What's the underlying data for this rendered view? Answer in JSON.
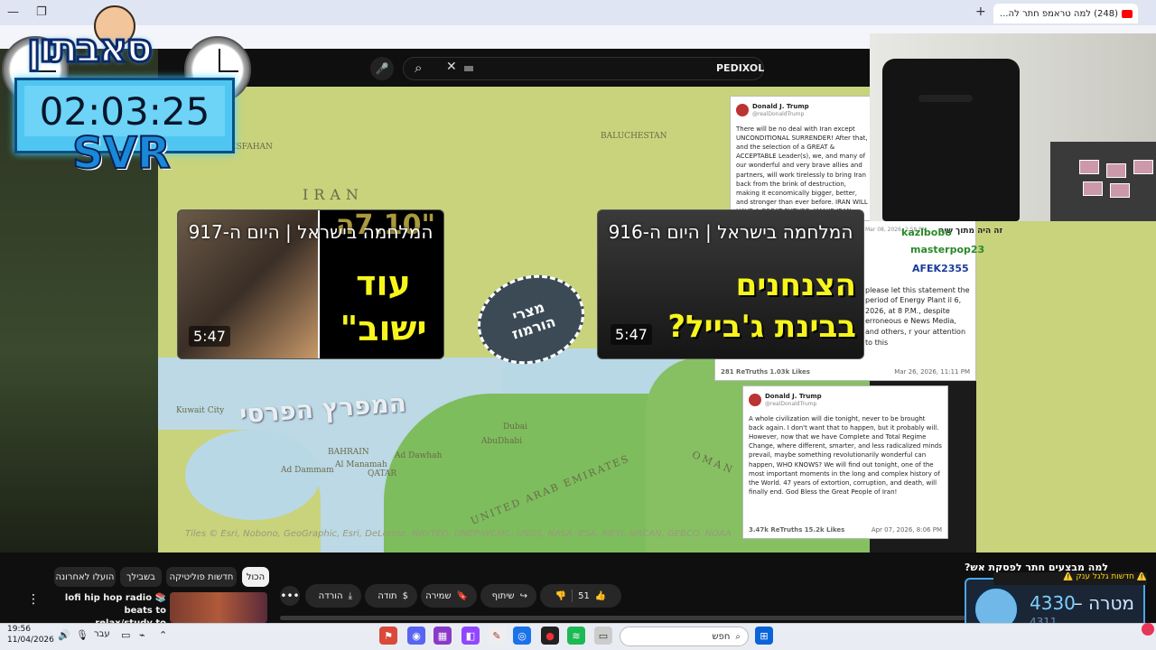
{
  "browser": {
    "tab_title": "(248) למה טראמפ חתר לה...",
    "new_tab": "+",
    "minimize": "—",
    "restore": "❐"
  },
  "overlay": {
    "brand": "סאבתון",
    "timer": "02:03:25",
    "svr": "SVR"
  },
  "search": {
    "channel": "PEDIXOL",
    "clear": "✕",
    "mic": "🎤",
    "search_icon": "⌕"
  },
  "map": {
    "gulf_label": "המפרץ הפרסי",
    "labels": [
      "Kuwait City",
      "BAHRAIN",
      "Al Manamah",
      "Ad Dammam",
      "QATAR",
      "Ad Dawhah",
      "AbuDhabi",
      "Dubai",
      "UNITED ARAB EMIRATES",
      "OMAN",
      "ESFAHAN",
      "BALUCHESTAN",
      "IRAN"
    ],
    "credits": "Tiles © Esri, Nobono, GeoGraphic, Esri, DeLorme, NAVTEQ, UNEP-WCMC, USGS, NASA, ESA, METI, NRCAN, GEBCO, NOAA",
    "strait_label_line1": "מצרי",
    "strait_label_line2": "הורמוז"
  },
  "cards": [
    {
      "title": "המלחמה בישראל | היום ה-917",
      "duration": "5:47",
      "quote_top": "\"7.10ה",
      "yellow_line1": "עוד",
      "yellow_line2": "ישוב\""
    },
    {
      "title": "המלחמה בישראל | היום ה-916",
      "duration": "5:47",
      "yellow_line1": "הצנחנים",
      "yellow_line2": "בבינת ג'בייל?"
    }
  ],
  "tweets": [
    {
      "name": "Donald J. Trump",
      "handle": "@realDonaldTrump",
      "body": "There will be no deal with Iran except UNCONDITIONAL SURRENDER! After that, and the selection of a GREAT & ACCEPTABLE Leader(s), we, and many of our wonderful and very brave allies and partners, will work tirelessly to bring Iran back from the brink of destruction, making it economically bigger, better, and stronger than ever before. IRAN WILL HAVE A GREAT FUTURE. \"MAKE IRAN GREAT AGAIN (MIGA!)\"...",
      "retruths": "281 ReTruths",
      "likes": "1.03k Likes",
      "date": "Mar 26, 2026, 11:11 PM",
      "body_tail": "please let this statement the period of Energy Plant il 6, 2026, at 8 P.M., despite erroneous e News Media, and others, r your attention to this"
    },
    {
      "name": "Donald J. Trump",
      "handle": "@realDonaldTrump",
      "body": "A whole civilization will die tonight, never to be brought back again. I don't want that to happen, but it probably will. However, now that we have Complete and Total Regime Change, where different, smarter, and less radicalized minds prevail, maybe something revolutionarily wonderful can happen, WHO KNOWS? We will find out tonight, one of the most important moments in the long and complex history of the World. 47 years of extortion, corruption, and death, will finally end. God Bless the Great People of Iran!",
      "retruths": "3.47k ReTruths",
      "likes": "15.2k Likes",
      "date": "Apr 07, 2026, 8:06 PM"
    }
  ],
  "tweet_stamp": "Mar 08, 2026, 2:58 PM",
  "chat": {
    "notice": "זה היה מתוך שיר",
    "users": [
      "kazlbobo",
      "masterpop23",
      "AFEK2355"
    ]
  },
  "bottom": {
    "chips": [
      "הכול",
      "חדשות פוליטיקה",
      "בשבילך",
      "הועלו לאחרונה"
    ],
    "like_count": "51",
    "share": "שיתוף",
    "save": "שמירה",
    "thanks": "תודה",
    "download": "הורדה",
    "more": "•••",
    "kebab": "⋮",
    "lofi_line1": "lofi hip hop radio 📚 beats to",
    "lofi_line2": "relax/study to",
    "next_title": "למה מבצעים חתר לפסקת אש?",
    "notif": "⚠️ חדשות גלגל ענק ⚠️"
  },
  "goal": {
    "label": "מטרה –",
    "current": "4330",
    "total": "4311"
  },
  "taskbar": {
    "time": "19:56",
    "date": "11/04/2026",
    "lang": "עבר",
    "search_placeholder": "חפש"
  },
  "colors": {
    "accent_blue": "#4aa8e8",
    "yellow": "#f7f51c",
    "map_land": "#c8d37c",
    "map_green": "#7dbd5d"
  }
}
